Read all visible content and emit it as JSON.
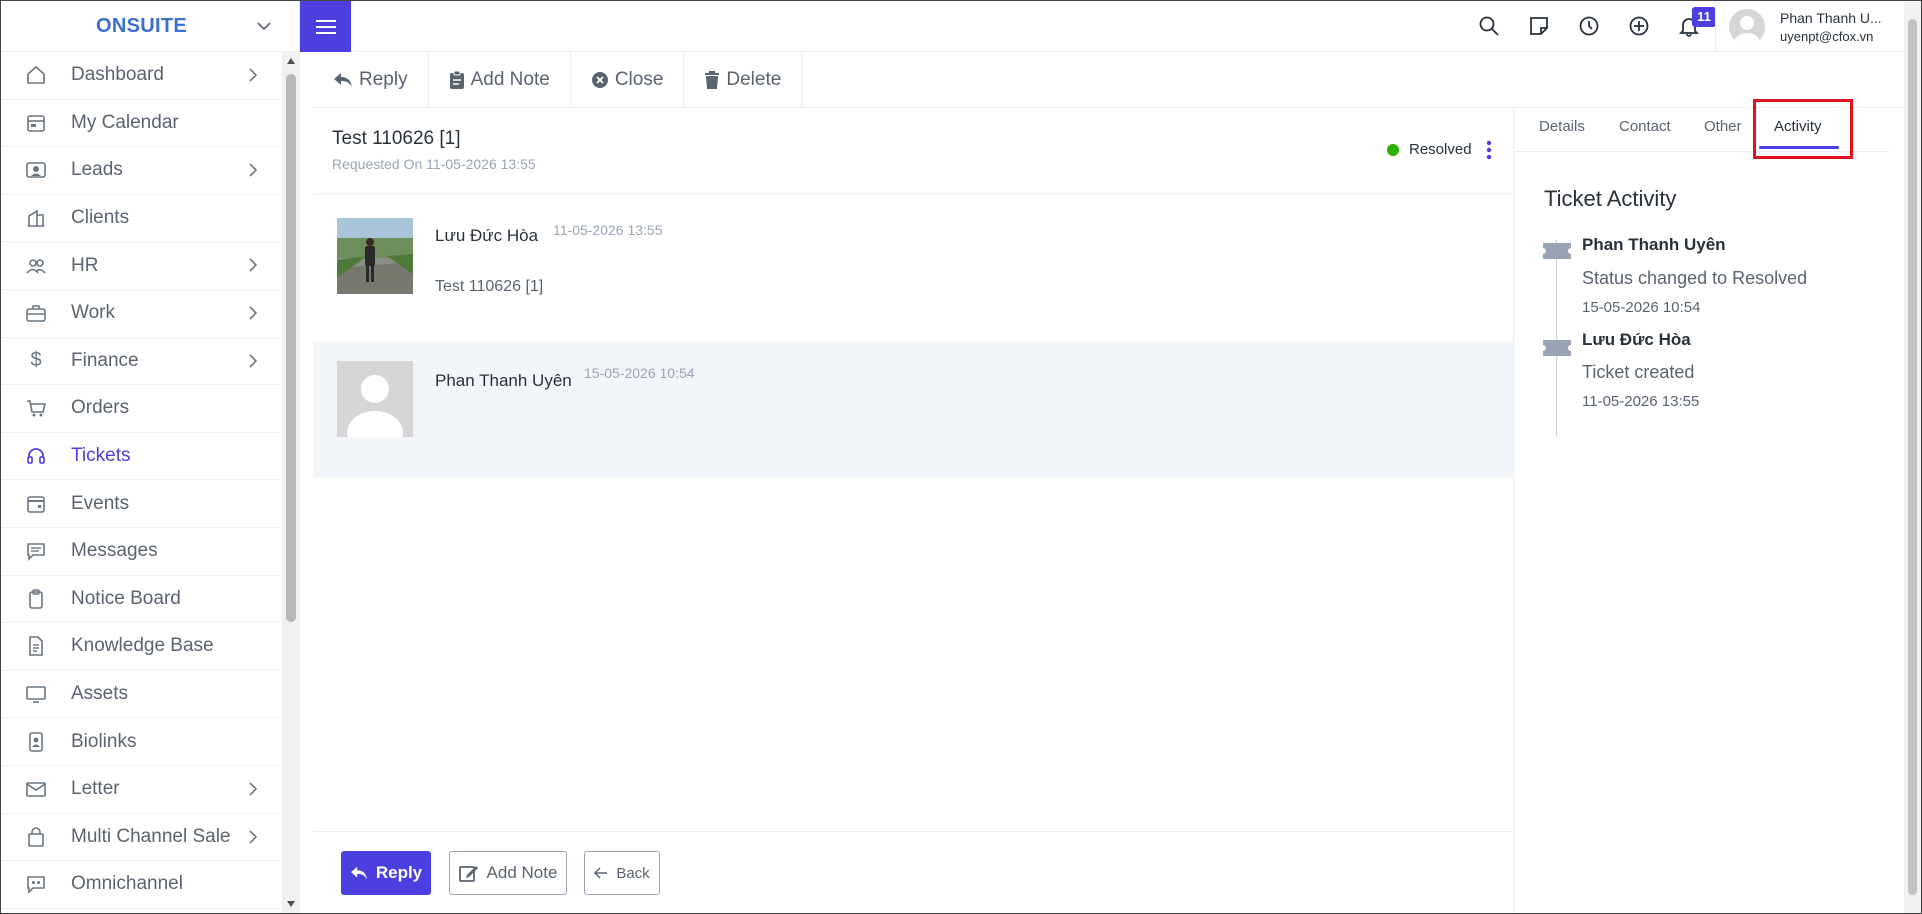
{
  "brand": {
    "name": "ONSUITE"
  },
  "sidebar": {
    "items": [
      {
        "label": "Dashboard",
        "icon": "home-icon",
        "chevron": true
      },
      {
        "label": "My Calendar",
        "icon": "calendar-icon",
        "chevron": false
      },
      {
        "label": "Leads",
        "icon": "person-card-icon",
        "chevron": true
      },
      {
        "label": "Clients",
        "icon": "building-icon",
        "chevron": false
      },
      {
        "label": "HR",
        "icon": "people-icon",
        "chevron": true
      },
      {
        "label": "Work",
        "icon": "briefcase-icon",
        "chevron": true
      },
      {
        "label": "Finance",
        "icon": "dollar-icon",
        "chevron": true
      },
      {
        "label": "Orders",
        "icon": "cart-icon",
        "chevron": false
      },
      {
        "label": "Tickets",
        "icon": "headset-icon",
        "chevron": false,
        "active": true
      },
      {
        "label": "Events",
        "icon": "calendar-event-icon",
        "chevron": false
      },
      {
        "label": "Messages",
        "icon": "chat-icon",
        "chevron": false
      },
      {
        "label": "Notice Board",
        "icon": "clipboard-icon",
        "chevron": false
      },
      {
        "label": "Knowledge Base",
        "icon": "document-icon",
        "chevron": false
      },
      {
        "label": "Assets",
        "icon": "monitor-icon",
        "chevron": false
      },
      {
        "label": "Biolinks",
        "icon": "badge-icon",
        "chevron": false
      },
      {
        "label": "Letter",
        "icon": "envelope-icon",
        "chevron": true
      },
      {
        "label": "Multi Channel Sale",
        "icon": "bag-icon",
        "chevron": true
      },
      {
        "label": "Omnichannel",
        "icon": "chat-quote-icon",
        "chevron": false
      }
    ]
  },
  "topbar": {
    "notification_count": "11",
    "user_name": "Phan Thanh U...",
    "user_email": "uyenpt@cfox.vn"
  },
  "actions": {
    "reply": "Reply",
    "add_note": "Add Note",
    "close": "Close",
    "delete": "Delete"
  },
  "ticket": {
    "title": "Test 110626 [1]",
    "requested_on": "Requested On 11-05-2026 13:55",
    "status": "Resolved",
    "status_color": "#2cb100"
  },
  "messages": [
    {
      "author": "Lưu Đức Hòa",
      "date": "11-05-2026 13:55",
      "body": "Test 110626 [1]"
    },
    {
      "author": "Phan Thanh Uyên",
      "date": "15-05-2026 10:54",
      "body": ""
    }
  ],
  "footer": {
    "reply": "Reply",
    "add_note": "Add Note",
    "back": "Back"
  },
  "panel": {
    "tabs": [
      "Details",
      "Contact",
      "Other",
      "Activity"
    ],
    "active_tab": "Activity",
    "title": "Ticket Activity",
    "activity": [
      {
        "name": "Phan Thanh Uyên",
        "detail": "Status changed to Resolved",
        "date": "15-05-2026 10:54"
      },
      {
        "name": "Lưu Đức Hòa",
        "detail": "Ticket created",
        "date": "11-05-2026 13:55"
      }
    ]
  },
  "colors": {
    "accent": "#4b3fe0",
    "brand": "#3d6fd0",
    "highlight": "#e0121e"
  }
}
